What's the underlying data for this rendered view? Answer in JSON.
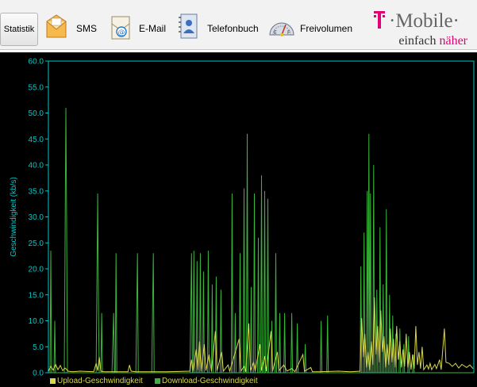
{
  "toolbar": {
    "items": [
      {
        "label": "Statistik",
        "icon": "chart-icon"
      },
      {
        "label": "SMS",
        "icon": "sms-envelope-icon"
      },
      {
        "label": "E-Mail",
        "icon": "email-icon"
      },
      {
        "label": "Telefonbuch",
        "icon": "phonebook-icon"
      },
      {
        "label": "Freivolumen",
        "icon": "gauge-icon"
      }
    ]
  },
  "brand": {
    "logo_text": "·Mobile·",
    "tagline_prefix": "einfach ",
    "tagline_accent": "näher",
    "magenta": "#e20074"
  },
  "chart_data": {
    "type": "line",
    "ylabel": "Geschwindigkeit (kb/s)",
    "ylim": [
      0,
      60
    ],
    "yticks": [
      "0.0",
      "5.0",
      "10.0",
      "15.0",
      "20.0",
      "25.0",
      "30.0",
      "35.0",
      "40.0",
      "45.0",
      "50.0",
      "55.0",
      "60.0"
    ],
    "axis_color": "#00c8c8",
    "series": [
      {
        "name": "Upload-Geschwindigkeit",
        "color": "#d8d84a",
        "points": [
          [
            0,
            0.3
          ],
          [
            3,
            1.2
          ],
          [
            6,
            0.5
          ],
          [
            9,
            1.6
          ],
          [
            12,
            0.6
          ],
          [
            15,
            1.4
          ],
          [
            18,
            0.4
          ],
          [
            21,
            0.9
          ],
          [
            25,
            0.3
          ],
          [
            30,
            0.2
          ],
          [
            40,
            0.3
          ],
          [
            57,
            0.2
          ],
          [
            60,
            1.8
          ],
          [
            62,
            0.4
          ],
          [
            64,
            3.0
          ],
          [
            66,
            0.3
          ],
          [
            70,
            0.2
          ],
          [
            100,
            0.2
          ],
          [
            102,
            1.5
          ],
          [
            104,
            0.3
          ],
          [
            110,
            0.2
          ],
          [
            150,
            0.2
          ],
          [
            178,
            0.3
          ],
          [
            180,
            2.5
          ],
          [
            182,
            0.4
          ],
          [
            186,
            4.5
          ],
          [
            188,
            0.5
          ],
          [
            190,
            6.0
          ],
          [
            192,
            0.3
          ],
          [
            196,
            5.5
          ],
          [
            198,
            0.4
          ],
          [
            202,
            3.5
          ],
          [
            205,
            0.3
          ],
          [
            210,
            8.0
          ],
          [
            212,
            0.4
          ],
          [
            218,
            4.0
          ],
          [
            220,
            0.3
          ],
          [
            226,
            1.5
          ],
          [
            228,
            0.3
          ],
          [
            240,
            6.5
          ],
          [
            242,
            0.3
          ],
          [
            246,
            1.2
          ],
          [
            248,
            0.2
          ],
          [
            252,
            9.5
          ],
          [
            254,
            0.4
          ],
          [
            258,
            2.0
          ],
          [
            260,
            0.3
          ],
          [
            266,
            5.5
          ],
          [
            268,
            0.4
          ],
          [
            272,
            3.2
          ],
          [
            274,
            0.3
          ],
          [
            280,
            8.0
          ],
          [
            282,
            0.3
          ],
          [
            288,
            4.0
          ],
          [
            290,
            0.4
          ],
          [
            296,
            1.5
          ],
          [
            300,
            0.3
          ],
          [
            306,
            0.8
          ],
          [
            310,
            0.2
          ],
          [
            320,
            3.5
          ],
          [
            322,
            0.3
          ],
          [
            330,
            1.0
          ],
          [
            332,
            0.2
          ],
          [
            340,
            0.2
          ],
          [
            365,
            0.3
          ],
          [
            380,
            0.2
          ],
          [
            392,
            0.3
          ],
          [
            394,
            10.5
          ],
          [
            396,
            3.0
          ],
          [
            398,
            7.5
          ],
          [
            400,
            1.0
          ],
          [
            402,
            4.0
          ],
          [
            404,
            0.5
          ],
          [
            406,
            6.0
          ],
          [
            408,
            1.5
          ],
          [
            410,
            14.5
          ],
          [
            412,
            3.5
          ],
          [
            414,
            9.0
          ],
          [
            416,
            2.0
          ],
          [
            418,
            12.0
          ],
          [
            420,
            4.0
          ],
          [
            422,
            7.0
          ],
          [
            424,
            1.0
          ],
          [
            426,
            5.5
          ],
          [
            428,
            1.5
          ],
          [
            430,
            8.5
          ],
          [
            432,
            2.0
          ],
          [
            434,
            6.5
          ],
          [
            436,
            1.0
          ],
          [
            438,
            9.0
          ],
          [
            440,
            2.5
          ],
          [
            442,
            6.0
          ],
          [
            444,
            1.0
          ],
          [
            446,
            4.5
          ],
          [
            448,
            1.2
          ],
          [
            450,
            7.5
          ],
          [
            452,
            1.0
          ],
          [
            454,
            4.0
          ],
          [
            456,
            0.6
          ],
          [
            458,
            3.5
          ],
          [
            460,
            0.8
          ],
          [
            462,
            9.0
          ],
          [
            464,
            1.5
          ],
          [
            466,
            4.0
          ],
          [
            468,
            0.8
          ],
          [
            470,
            5.0
          ],
          [
            472,
            0.6
          ],
          [
            476,
            1.5
          ],
          [
            478,
            0.7
          ],
          [
            480,
            1.8
          ],
          [
            482,
            0.6
          ],
          [
            486,
            1.6
          ],
          [
            488,
            0.8
          ],
          [
            492,
            2.5
          ],
          [
            494,
            0.6
          ],
          [
            498,
            8.5
          ],
          [
            500,
            2.0
          ],
          [
            504,
            1.8
          ],
          [
            508,
            1.2
          ],
          [
            512,
            1.8
          ],
          [
            516,
            0.9
          ],
          [
            520,
            1.6
          ],
          [
            526,
            1.0
          ],
          [
            530,
            1.5
          ],
          [
            534,
            0.8
          ]
        ]
      },
      {
        "name": "Download-Geschwindigkeit",
        "color": "#3ab43a",
        "points": [
          [
            0,
            0
          ],
          [
            2,
            0
          ],
          [
            3,
            23.5
          ],
          [
            4,
            0
          ],
          [
            7,
            0
          ],
          [
            8,
            10.0
          ],
          [
            9,
            0
          ],
          [
            20,
            0
          ],
          [
            22,
            51.0
          ],
          [
            23,
            28.0
          ],
          [
            24,
            0
          ],
          [
            60,
            0
          ],
          [
            62,
            34.5
          ],
          [
            63,
            12.0
          ],
          [
            64,
            0
          ],
          [
            66,
            0
          ],
          [
            67,
            11.5
          ],
          [
            68,
            0
          ],
          [
            80,
            0
          ],
          [
            82,
            11.5
          ],
          [
            83,
            0
          ],
          [
            84,
            0
          ],
          [
            85,
            23.0
          ],
          [
            86,
            0
          ],
          [
            110,
            0
          ],
          [
            112,
            23.0
          ],
          [
            113,
            0
          ],
          [
            130,
            0
          ],
          [
            132,
            23.0
          ],
          [
            133,
            0
          ],
          [
            178,
            0
          ],
          [
            180,
            23.0
          ],
          [
            181,
            0
          ],
          [
            182,
            0
          ],
          [
            183,
            23.5
          ],
          [
            184,
            0
          ],
          [
            186,
            0
          ],
          [
            187,
            21.5
          ],
          [
            188,
            0
          ],
          [
            190,
            0
          ],
          [
            191,
            23.0
          ],
          [
            192,
            0
          ],
          [
            194,
            0
          ],
          [
            195,
            19.5
          ],
          [
            196,
            0
          ],
          [
            200,
            0
          ],
          [
            201,
            23.5
          ],
          [
            202,
            0
          ],
          [
            205,
            0
          ],
          [
            206,
            17.0
          ],
          [
            207,
            0
          ],
          [
            210,
            0
          ],
          [
            211,
            18.5
          ],
          [
            212,
            0
          ],
          [
            216,
            0
          ],
          [
            217,
            16.0
          ],
          [
            218,
            0
          ],
          [
            230,
            0
          ],
          [
            231,
            34.5
          ],
          [
            232,
            0
          ],
          [
            234,
            0
          ],
          [
            235,
            11.5
          ],
          [
            236,
            0
          ],
          [
            240,
            0
          ],
          [
            241,
            23.0
          ],
          [
            242,
            0
          ],
          [
            245,
            0
          ],
          [
            246,
            35.5
          ],
          [
            247,
            0
          ],
          [
            249,
            0
          ],
          [
            250,
            46.0
          ],
          [
            251,
            0
          ],
          [
            254,
            0
          ],
          [
            255,
            16.5
          ],
          [
            256,
            0
          ],
          [
            258,
            0
          ],
          [
            259,
            34.5
          ],
          [
            260,
            0
          ],
          [
            263,
            0
          ],
          [
            264,
            26.0
          ],
          [
            265,
            0
          ],
          [
            267,
            0
          ],
          [
            268,
            38.0
          ],
          [
            269,
            0
          ],
          [
            271,
            0
          ],
          [
            272,
            35.0
          ],
          [
            273,
            0
          ],
          [
            275,
            0
          ],
          [
            276,
            33.5
          ],
          [
            277,
            0
          ],
          [
            280,
            0
          ],
          [
            281,
            10.0
          ],
          [
            282,
            0
          ],
          [
            285,
            0
          ],
          [
            286,
            23.0
          ],
          [
            287,
            0
          ],
          [
            290,
            0
          ],
          [
            291,
            11.5
          ],
          [
            292,
            0
          ],
          [
            296,
            0
          ],
          [
            297,
            11.5
          ],
          [
            298,
            0
          ],
          [
            305,
            0
          ],
          [
            306,
            11.5
          ],
          [
            307,
            0
          ],
          [
            312,
            0
          ],
          [
            313,
            9.5
          ],
          [
            314,
            0
          ],
          [
            322,
            0
          ],
          [
            323,
            5.5
          ],
          [
            324,
            0
          ],
          [
            342,
            0
          ],
          [
            343,
            10.0
          ],
          [
            344,
            0
          ],
          [
            350,
            0
          ],
          [
            351,
            11.0
          ],
          [
            352,
            0
          ],
          [
            392,
            0
          ],
          [
            393,
            20.5
          ],
          [
            394,
            0
          ],
          [
            396,
            0
          ],
          [
            397,
            27.0
          ],
          [
            398,
            0
          ],
          [
            400,
            0
          ],
          [
            401,
            35.0
          ],
          [
            402,
            0
          ],
          [
            403,
            46.0
          ],
          [
            404,
            0
          ],
          [
            405,
            34.5
          ],
          [
            406,
            0
          ],
          [
            408,
            0
          ],
          [
            409,
            40.0
          ],
          [
            410,
            0
          ],
          [
            412,
            0
          ],
          [
            413,
            16.0
          ],
          [
            414,
            0
          ],
          [
            416,
            0
          ],
          [
            417,
            28.0
          ],
          [
            418,
            0
          ],
          [
            420,
            0
          ],
          [
            421,
            17.0
          ],
          [
            422,
            0
          ],
          [
            424,
            0
          ],
          [
            425,
            31.5
          ],
          [
            426,
            0
          ],
          [
            428,
            0
          ],
          [
            429,
            15.0
          ],
          [
            430,
            0
          ],
          [
            432,
            0
          ],
          [
            433,
            11.0
          ],
          [
            434,
            0
          ],
          [
            436,
            0
          ],
          [
            437,
            7.5
          ],
          [
            438,
            0
          ],
          [
            441,
            0
          ],
          [
            442,
            8.5
          ],
          [
            443,
            0
          ],
          [
            446,
            0
          ],
          [
            447,
            5.5
          ],
          [
            448,
            0
          ],
          [
            452,
            0
          ],
          [
            453,
            7.0
          ],
          [
            454,
            0
          ],
          [
            458,
            0
          ],
          [
            459,
            3.5
          ],
          [
            460,
            0
          ],
          [
            535,
            0
          ]
        ]
      }
    ]
  }
}
